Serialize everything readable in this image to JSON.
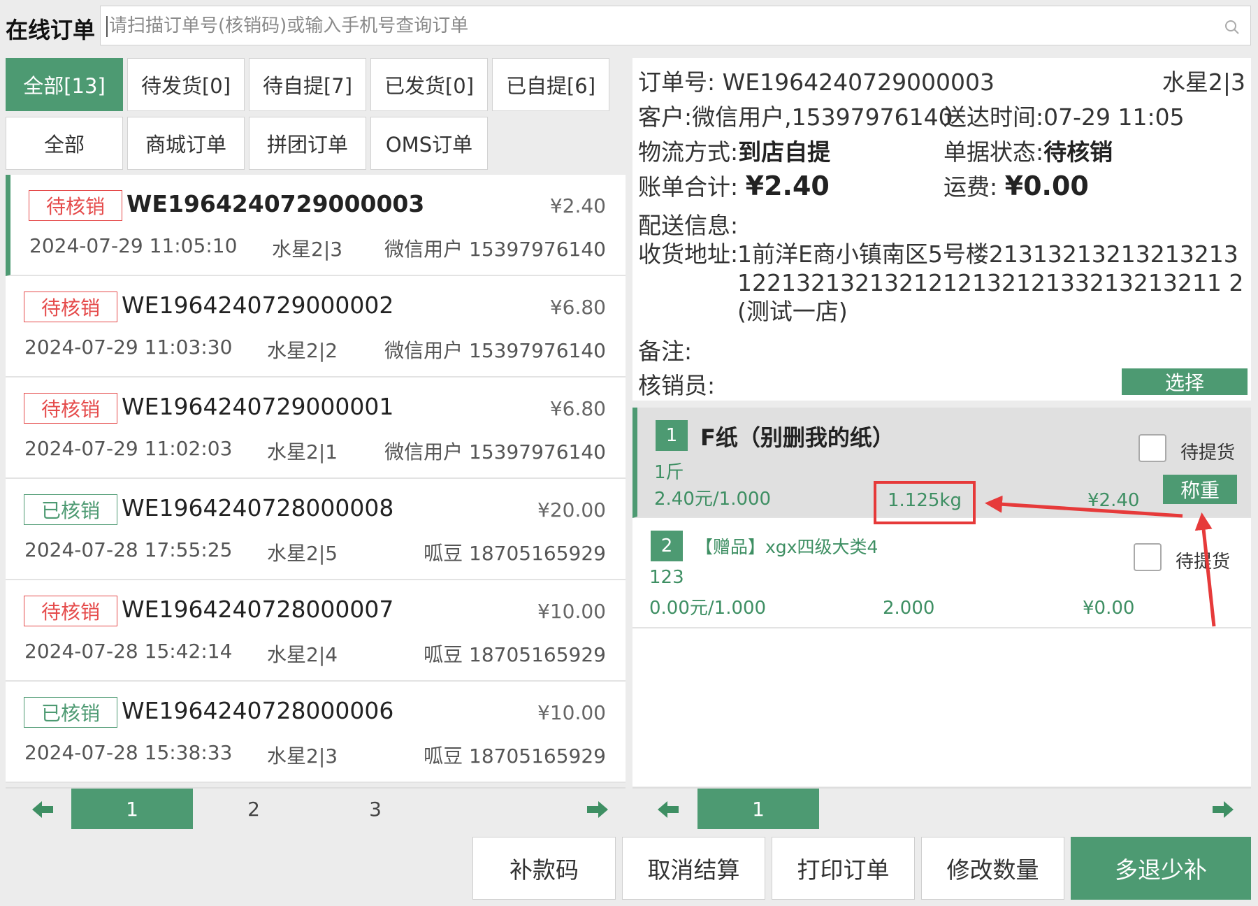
{
  "header": {
    "title": "在线订单",
    "search_placeholder": "请扫描订单号(核销码)或输入手机号查询订单"
  },
  "status_tabs": [
    "全部[13]",
    "待发货[0]",
    "待自提[7]",
    "已发货[0]",
    "已自提[6]"
  ],
  "type_tabs": [
    "全部",
    "商城订单",
    "拼团订单",
    "OMS订单"
  ],
  "orders": [
    {
      "status": "待核销",
      "no": "WE1964240729000003",
      "amount": "¥2.40",
      "time": "2024-07-29 11:05:10",
      "seat": "水星2|3",
      "customer": "微信用户 15397976140"
    },
    {
      "status": "待核销",
      "no": "WE1964240729000002",
      "amount": "¥6.80",
      "time": "2024-07-29 11:03:30",
      "seat": "水星2|2",
      "customer": "微信用户 15397976140"
    },
    {
      "status": "待核销",
      "no": "WE1964240729000001",
      "amount": "¥6.80",
      "time": "2024-07-29 11:02:03",
      "seat": "水星2|1",
      "customer": "微信用户 15397976140"
    },
    {
      "status": "已核销",
      "no": "WE1964240728000008",
      "amount": "¥20.00",
      "time": "2024-07-28 17:55:25",
      "seat": "水星2|5",
      "customer": "呱豆 18705165929"
    },
    {
      "status": "待核销",
      "no": "WE1964240728000007",
      "amount": "¥10.00",
      "time": "2024-07-28 15:42:14",
      "seat": "水星2|4",
      "customer": "呱豆 18705165929"
    },
    {
      "status": "已核销",
      "no": "WE1964240728000006",
      "amount": "¥10.00",
      "time": "2024-07-28 15:38:33",
      "seat": "水星2|3",
      "customer": "呱豆 18705165929"
    }
  ],
  "order_pager": {
    "pages": [
      "1",
      "2",
      "3"
    ],
    "current": "1"
  },
  "detail": {
    "order_no_label": "订单号:",
    "order_no": "WE1964240729000003",
    "seat": "水星2|3",
    "customer_label": "客户:",
    "customer": "微信用户,15397976140",
    "delivery_time_label": "送达时间:",
    "delivery_time": "07-29 11:05",
    "logistics_label": "物流方式:",
    "logistics": "到店自提",
    "doc_status_label": "单据状态:",
    "doc_status": "待核销",
    "bill_total_label": "账单合计:",
    "bill_total": "¥2.40",
    "freight_label": "运费:",
    "freight": "¥0.00",
    "delivery_info_label": "配送信息:",
    "address_label": "收货地址:",
    "address": "1前洋E商小镇南区5号楼21313213213213213122132132132121213212133213213211 2(测试一店)",
    "remark_label": "备注:",
    "verifier_label": "核销员:",
    "select_button": "选择"
  },
  "items": [
    {
      "index": "1",
      "name": "F纸（别删我的纸）",
      "unit": "1斤",
      "price": "2.40元/1.000",
      "qty": "1.125kg",
      "subtotal": "¥2.40",
      "check_label": "待提货",
      "weigh_button": "称重"
    },
    {
      "index": "2",
      "name": "【赠品】xgx四级大类4",
      "unit": "123",
      "price": "0.00元/1.000",
      "qty": "2.000",
      "subtotal": "¥0.00",
      "check_label": "待提货"
    }
  ],
  "item_pager": {
    "pages": [
      "1"
    ],
    "current": "1"
  },
  "actions": [
    "补款码",
    "取消结算",
    "打印订单",
    "修改数量",
    "多退少补"
  ],
  "colors": {
    "primary": "#4d9a72",
    "pending": "#e54b4b",
    "annotation": "#e63a3a"
  },
  "icons": [
    "search-icon",
    "arrow-left-icon",
    "arrow-right-icon"
  ]
}
